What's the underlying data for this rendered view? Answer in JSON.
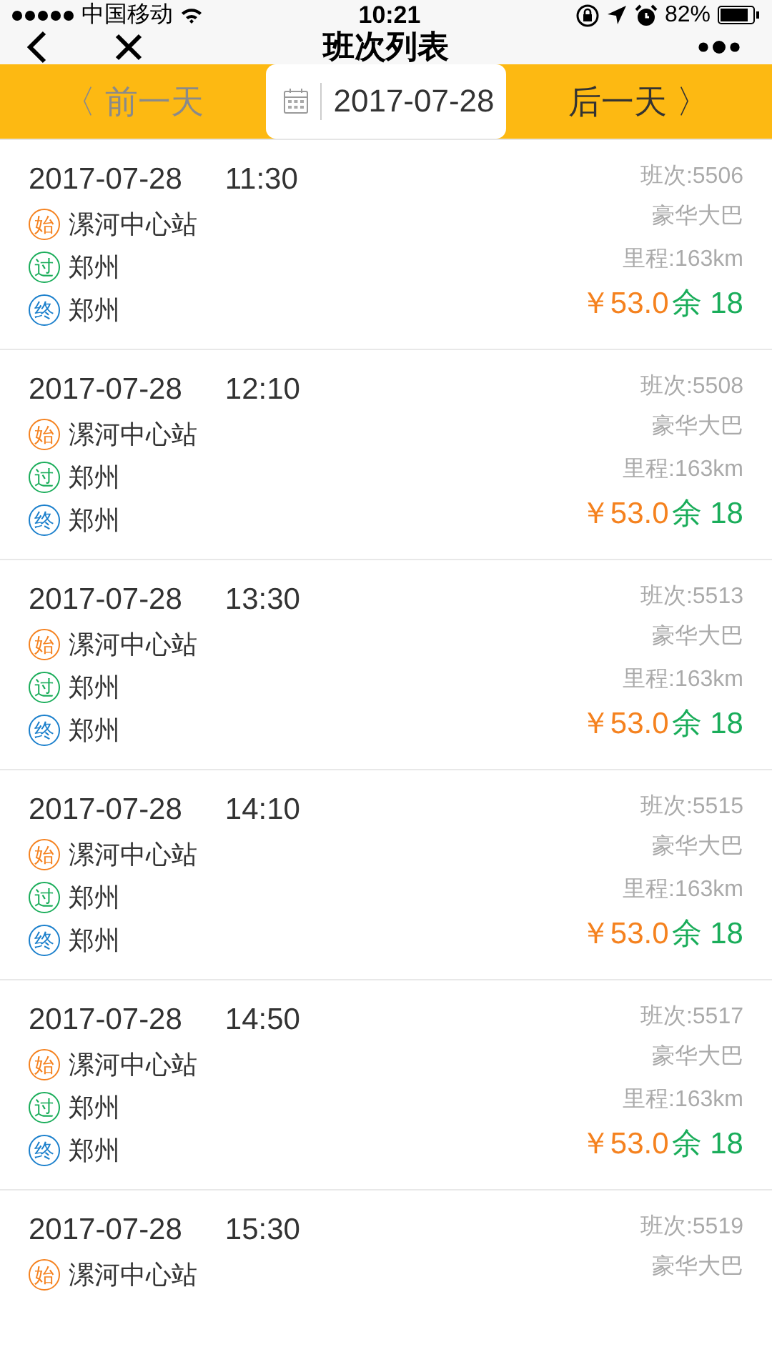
{
  "status_bar": {
    "carrier": "中国移动",
    "time": "10:21",
    "battery": "82%"
  },
  "nav": {
    "title": "班次列表"
  },
  "date_bar": {
    "prev": {
      "label": "〈 前一天",
      "disabled": true
    },
    "date": "2017-07-28",
    "next": {
      "label": "后一天 〉",
      "disabled": false
    }
  },
  "trips": [
    {
      "date": "2017-07-28",
      "time": "11:30",
      "code": "班次:5506",
      "bus": "豪华大巴",
      "distance": "里程:163km",
      "price": "￥53.0",
      "seats": "余 18",
      "stops": [
        {
          "badge": "始",
          "name": "漯河中心站",
          "color": "#f5821f"
        },
        {
          "badge": "过",
          "name": "郑州",
          "color": "#1aad5a"
        },
        {
          "badge": "终",
          "name": "郑州",
          "color": "#1a7fcc"
        }
      ]
    },
    {
      "date": "2017-07-28",
      "time": "12:10",
      "code": "班次:5508",
      "bus": "豪华大巴",
      "distance": "里程:163km",
      "price": "￥53.0",
      "seats": "余 18",
      "stops": [
        {
          "badge": "始",
          "name": "漯河中心站",
          "color": "#f5821f"
        },
        {
          "badge": "过",
          "name": "郑州",
          "color": "#1aad5a"
        },
        {
          "badge": "终",
          "name": "郑州",
          "color": "#1a7fcc"
        }
      ]
    },
    {
      "date": "2017-07-28",
      "time": "13:30",
      "code": "班次:5513",
      "bus": "豪华大巴",
      "distance": "里程:163km",
      "price": "￥53.0",
      "seats": "余 18",
      "stops": [
        {
          "badge": "始",
          "name": "漯河中心站",
          "color": "#f5821f"
        },
        {
          "badge": "过",
          "name": "郑州",
          "color": "#1aad5a"
        },
        {
          "badge": "终",
          "name": "郑州",
          "color": "#1a7fcc"
        }
      ]
    },
    {
      "date": "2017-07-28",
      "time": "14:10",
      "code": "班次:5515",
      "bus": "豪华大巴",
      "distance": "里程:163km",
      "price": "￥53.0",
      "seats": "余 18",
      "stops": [
        {
          "badge": "始",
          "name": "漯河中心站",
          "color": "#f5821f"
        },
        {
          "badge": "过",
          "name": "郑州",
          "color": "#1aad5a"
        },
        {
          "badge": "终",
          "name": "郑州",
          "color": "#1a7fcc"
        }
      ]
    },
    {
      "date": "2017-07-28",
      "time": "14:50",
      "code": "班次:5517",
      "bus": "豪华大巴",
      "distance": "里程:163km",
      "price": "￥53.0",
      "seats": "余 18",
      "stops": [
        {
          "badge": "始",
          "name": "漯河中心站",
          "color": "#f5821f"
        },
        {
          "badge": "过",
          "name": "郑州",
          "color": "#1aad5a"
        },
        {
          "badge": "终",
          "name": "郑州",
          "color": "#1a7fcc"
        }
      ]
    },
    {
      "date": "2017-07-28",
      "time": "15:30",
      "code": "班次:5519",
      "bus": "豪华大巴",
      "stops": [
        {
          "badge": "始",
          "name": "漯河中心站",
          "color": "#f5821f"
        }
      ]
    }
  ]
}
